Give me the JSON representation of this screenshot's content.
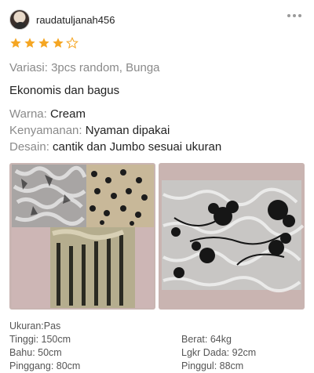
{
  "user": {
    "username": "raudatuljanah456"
  },
  "rating": {
    "value": 4,
    "max": 5,
    "filled_color": "#f5a623"
  },
  "variation": {
    "label": "Variasi:",
    "value": "3pcs random, Bunga"
  },
  "comment": "Ekonomis dan bagus",
  "attributes": [
    {
      "label": "Warna:",
      "value": "Cream"
    },
    {
      "label": "Kenyamanan:",
      "value": "Nyaman dipakai"
    },
    {
      "label": "Desain:",
      "value": "cantik dan Jumbo sesuai ukuran"
    }
  ],
  "size_info": {
    "ukuran": "Ukuran:Pas",
    "left": [
      "Tinggi: 150cm",
      "Bahu: 50cm",
      "Pinggang: 80cm"
    ],
    "right": [
      "Berat: 64kg",
      "Lgkr Dada: 92cm",
      "Pinggul: 88cm"
    ]
  },
  "icons": {
    "more": "more-dots-icon",
    "star": "star-icon"
  }
}
